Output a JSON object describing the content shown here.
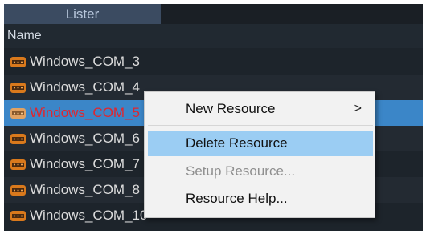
{
  "tabs": [
    {
      "label": "Lister"
    }
  ],
  "list": {
    "column_header": "Name",
    "items": [
      {
        "label": "Windows_COM_3"
      },
      {
        "label": "Windows_COM_4"
      },
      {
        "label": "Windows_COM_5"
      },
      {
        "label": "Windows_COM_6"
      },
      {
        "label": "Windows_COM_7"
      },
      {
        "label": "Windows_COM_8"
      },
      {
        "label": "Windows_COM_10"
      }
    ],
    "icon": "serial-port-icon",
    "selected_index": 2
  },
  "context_menu": {
    "items": [
      {
        "label": "New Resource",
        "submenu_arrow": ">"
      },
      {
        "label": "Delete Resource"
      },
      {
        "label": "Setup Resource..."
      },
      {
        "label": "Resource Help..."
      }
    ]
  },
  "colors": {
    "panel_bg": "#1d242b",
    "tab_bg": "#3b4b61",
    "selection_bg": "#3b86c8",
    "selected_text": "#e0262e",
    "menu_bg": "#f2f2f2",
    "menu_hover": "#9bcdf3"
  }
}
